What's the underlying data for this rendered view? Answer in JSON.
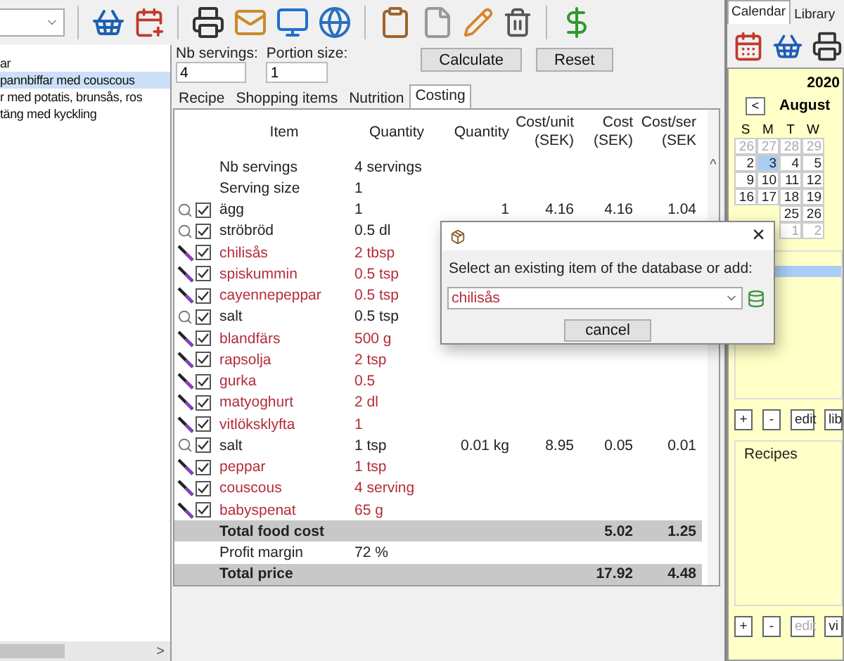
{
  "left_panel": {
    "items": [
      {
        "label": "ar",
        "selected": false
      },
      {
        "label": "pannbiffar med couscous",
        "selected": true
      },
      {
        "label": "r med potatis, brunsås, ros",
        "selected": false
      },
      {
        "label": "täng med kyckling",
        "selected": false
      }
    ],
    "scroll_arrow": ">"
  },
  "servings": {
    "label": "Nb servings:",
    "value": "4"
  },
  "portion": {
    "label": "Portion size:",
    "value": "1"
  },
  "buttons": [
    "Calculate",
    "Reset"
  ],
  "tabs": [
    {
      "label": "Recipe",
      "selected": false
    },
    {
      "label": "Shopping items",
      "selected": false
    },
    {
      "label": "Nutrition",
      "selected": false
    },
    {
      "label": "Costing",
      "selected": true
    }
  ],
  "table": {
    "columns": [
      [
        "Item"
      ],
      [
        "Quantity"
      ],
      [
        "Quantity"
      ],
      [
        "Cost/unit",
        "(SEK)"
      ],
      [
        "Cost",
        "(SEK)"
      ],
      [
        "Cost/ser",
        "(SEK"
      ]
    ],
    "scroll_arrow": "^",
    "rows": [
      {
        "kind": "info",
        "item": "Nb servings",
        "quantity": "4 servings"
      },
      {
        "kind": "info",
        "item": "Serving size",
        "quantity": "1"
      },
      {
        "kind": "found",
        "checked": true,
        "unpriced": false,
        "item": "ägg",
        "quantity": "1",
        "quantity_2": "1",
        "cost_unit": "4.16",
        "cost": "4.16",
        "cost_serving": "1.04"
      },
      {
        "kind": "found",
        "checked": true,
        "unpriced": false,
        "item": "ströbröd",
        "quantity": "0.5 dl"
      },
      {
        "kind": "new",
        "checked": true,
        "unpriced": true,
        "item": "chilisås",
        "quantity": "2 tbsp"
      },
      {
        "kind": "new",
        "checked": true,
        "unpriced": true,
        "item": "spiskummin",
        "quantity": "0.5 tsp"
      },
      {
        "kind": "new",
        "checked": true,
        "unpriced": true,
        "item": "cayennepeppar",
        "quantity": "0.5 tsp"
      },
      {
        "kind": "found",
        "checked": true,
        "unpriced": false,
        "item": "salt",
        "quantity": "0.5 tsp"
      },
      {
        "kind": "new",
        "checked": true,
        "unpriced": true,
        "item": "blandfärs",
        "quantity": "500 g"
      },
      {
        "kind": "new",
        "checked": true,
        "unpriced": true,
        "item": "rapsolja",
        "quantity": "2 tsp"
      },
      {
        "kind": "new",
        "checked": true,
        "unpriced": true,
        "item": "gurka",
        "quantity": "0.5"
      },
      {
        "kind": "new",
        "checked": true,
        "unpriced": true,
        "item": "matyoghurt",
        "quantity": "2 dl"
      },
      {
        "kind": "new",
        "checked": true,
        "unpriced": true,
        "item": "vitlöksklyfta",
        "quantity": "1"
      },
      {
        "kind": "found",
        "checked": true,
        "unpriced": false,
        "item": "salt",
        "quantity": "1 tsp",
        "quantity_2": "0.01 kg",
        "cost_unit": "8.95",
        "cost": "0.05",
        "cost_serving": "0.01"
      },
      {
        "kind": "new",
        "checked": true,
        "unpriced": true,
        "item": "peppar",
        "quantity": "1 tsp"
      },
      {
        "kind": "new",
        "checked": true,
        "unpriced": true,
        "item": "couscous",
        "quantity": "4 serving"
      },
      {
        "kind": "new",
        "checked": true,
        "unpriced": true,
        "item": "babyspenat",
        "quantity": "65 g"
      },
      {
        "kind": "total",
        "item": "Total food cost",
        "cost": "5.02",
        "cost_serving": "1.25"
      },
      {
        "kind": "info",
        "item": "Profit margin",
        "quantity": "72 %"
      },
      {
        "kind": "total",
        "item": "Total price",
        "cost": "17.92",
        "cost_serving": "4.48"
      }
    ]
  },
  "right_panel": {
    "tabs": [
      {
        "label": "Calendar",
        "selected": true
      },
      {
        "label": "Library",
        "selected": false
      }
    ],
    "calendar": {
      "year": "2020",
      "prev": "<",
      "month": "August",
      "weekdays": [
        "S",
        "M",
        "T",
        "W"
      ],
      "weeks": [
        [
          {
            "day": "26",
            "muted": true,
            "selected": false
          },
          {
            "day": "27",
            "muted": true,
            "selected": false
          },
          {
            "day": "28",
            "muted": true,
            "selected": false
          },
          {
            "day": "29",
            "muted": true,
            "selected": false
          }
        ],
        [
          {
            "day": "2",
            "muted": false,
            "selected": false
          },
          {
            "day": "3",
            "muted": false,
            "selected": true
          },
          {
            "day": "4",
            "muted": false,
            "selected": false
          },
          {
            "day": "5",
            "muted": false,
            "selected": false
          }
        ],
        [
          {
            "day": "9",
            "muted": false,
            "selected": false
          },
          {
            "day": "10",
            "muted": false,
            "selected": false
          },
          {
            "day": "11",
            "muted": false,
            "selected": false
          },
          {
            "day": "12",
            "muted": false,
            "selected": false
          }
        ],
        [
          {
            "day": "16",
            "muted": false,
            "selected": false
          },
          {
            "day": "17",
            "muted": false,
            "selected": false
          },
          {
            "day": "18",
            "muted": false,
            "selected": false
          },
          {
            "day": "19",
            "muted": false,
            "selected": false
          }
        ],
        [
          {
            "day": "25",
            "muted": false,
            "selected": false
          },
          {
            "day": "26",
            "muted": false,
            "selected": false
          }
        ],
        [
          {
            "day": "1",
            "muted": true,
            "selected": false
          },
          {
            "day": "2",
            "muted": true,
            "selected": false
          }
        ]
      ]
    },
    "meal_list": {
      "items": [
        {
          "selected": true
        }
      ]
    },
    "meal_buttons": [
      {
        "label": "+",
        "disabled": false
      },
      {
        "label": "-",
        "disabled": false
      },
      {
        "label": "edit",
        "disabled": false
      },
      {
        "label": "lib",
        "disabled": false
      }
    ],
    "recipes_title": "Recipes",
    "recipe_buttons": [
      {
        "label": "+",
        "disabled": false
      },
      {
        "label": "-",
        "disabled": false
      },
      {
        "label": "edit",
        "disabled": true
      },
      {
        "label": "vi",
        "disabled": false
      }
    ]
  },
  "dialog": {
    "message": "Select an existing item of the database or add:",
    "value": "chilisås",
    "close": "×",
    "button": "cancel"
  }
}
